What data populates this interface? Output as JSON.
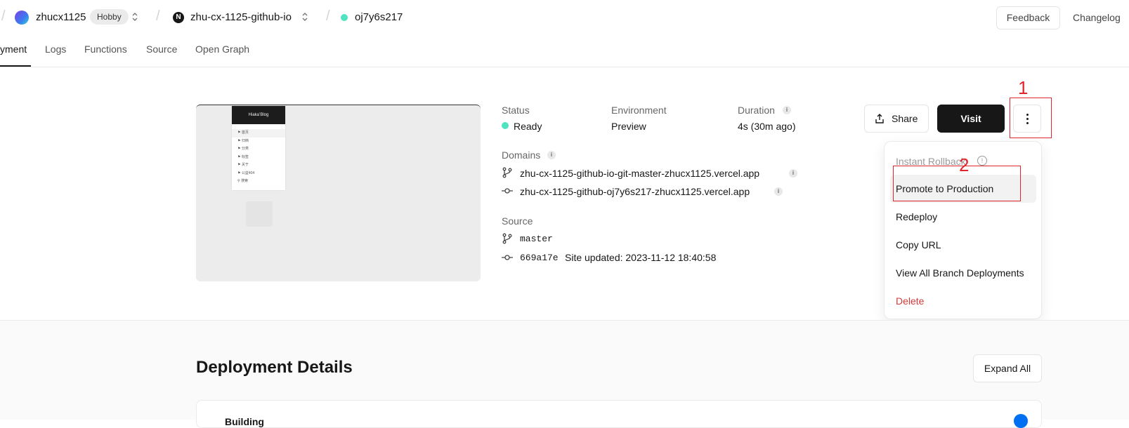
{
  "header": {
    "team": "zhucx1125",
    "plan_badge": "Hobby",
    "project": "zhu-cx-1125-github-io",
    "project_logo_letter": "N",
    "deployment_id": "oj7y6s217",
    "feedback": "Feedback",
    "changelog": "Changelog"
  },
  "tabs": [
    {
      "label": "yment",
      "active": true
    },
    {
      "label": "Logs"
    },
    {
      "label": "Functions"
    },
    {
      "label": "Source"
    },
    {
      "label": "Open Graph"
    }
  ],
  "preview": {
    "site_title": "Hiaka’Blog",
    "menu_items": [
      "首页",
      "归档",
      "分类",
      "标签",
      "关于",
      "公益404",
      "搜索"
    ]
  },
  "info": {
    "status_label": "Status",
    "status_value": "Ready",
    "environment_label": "Environment",
    "environment_value": "Preview",
    "duration_label": "Duration",
    "duration_value": "4s (30m ago)",
    "domains_label": "Domains",
    "domains": [
      "zhu-cx-1125-github-io-git-master-zhucx1125.vercel.app",
      "zhu-cx-1125-github-oj7y6s217-zhucx1125.vercel.app"
    ],
    "source_label": "Source",
    "branch": "master",
    "commit": "669a17e",
    "commit_message": "Site updated: 2023-11-12 18:40:58"
  },
  "actions": {
    "share": "Share",
    "visit": "Visit"
  },
  "annotations": {
    "one": "1",
    "two": "2"
  },
  "menu": {
    "instant_rollback": "Instant Rollback",
    "promote": "Promote to Production",
    "redeploy": "Redeploy",
    "copy_url": "Copy URL",
    "view_all": "View All Branch Deployments",
    "delete": "Delete"
  },
  "details": {
    "title": "Deployment Details",
    "expand_all": "Expand All",
    "building": "Building"
  },
  "colors": {
    "ready_dot": "#50e3c2",
    "primary_button": "#171717",
    "annotation_red": "#e0262c",
    "delete_red": "#d13a3a",
    "success_check": "#0070f3"
  }
}
